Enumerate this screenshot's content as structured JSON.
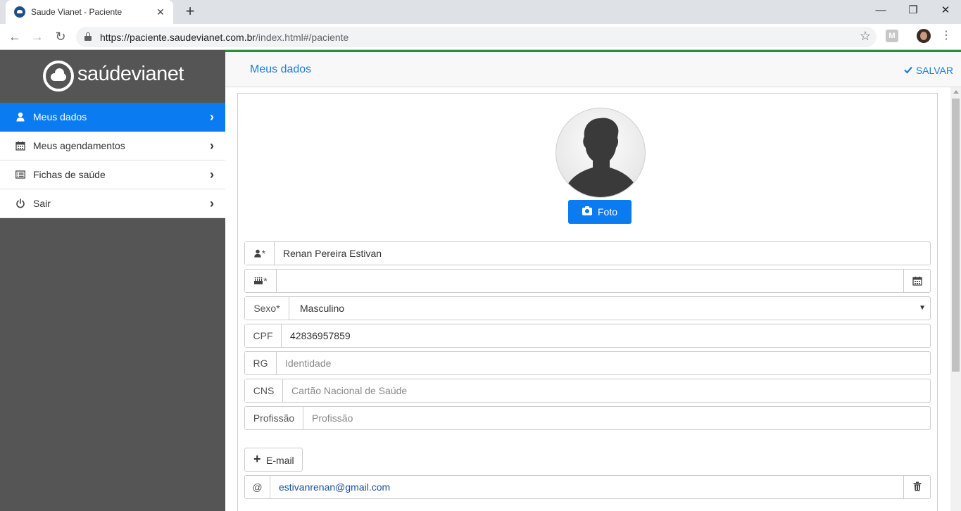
{
  "browser": {
    "tab_title": "Saude Vianet - Paciente",
    "url_scheme": "https://",
    "url_host": "paciente.saudevianet.com.br",
    "url_path": "/index.html#/paciente",
    "extension_label": "M"
  },
  "sidebar": {
    "brand": "saúdevianet",
    "items": [
      {
        "label": "Meus dados",
        "icon": "user-icon",
        "active": true
      },
      {
        "label": "Meus agendamentos",
        "icon": "calendar-icon",
        "active": false
      },
      {
        "label": "Fichas de saúde",
        "icon": "list-icon",
        "active": false
      },
      {
        "label": "Sair",
        "icon": "power-icon",
        "active": false
      }
    ]
  },
  "topbar": {
    "title": "Meus dados",
    "save_label": "SALVAR"
  },
  "profile": {
    "photo_button": "Foto",
    "fields": {
      "name": {
        "addon": "*",
        "icon": "user-icon",
        "value": "Renan Pereira Estivan"
      },
      "birthdate": {
        "addon": "*",
        "icon": "birthday-cake-icon",
        "value": ""
      },
      "sex": {
        "addon": "Sexo*",
        "value": "Masculino"
      },
      "cpf": {
        "addon": "CPF",
        "value": "42836957859"
      },
      "rg": {
        "addon": "RG",
        "placeholder": "Identidade"
      },
      "cns": {
        "addon": "CNS",
        "placeholder": "Cartão Nacional de Saúde"
      },
      "profession": {
        "addon": "Profissão",
        "placeholder": "Profissão"
      }
    },
    "add_email_label": "E-mail",
    "email": {
      "addon": "@",
      "value": "estivanrenan@gmail.com"
    }
  },
  "colors": {
    "primary": "#0a7bf0",
    "sidebar_bg": "#555555",
    "topbar_accent": "#2a8f3c",
    "link": "#1a7fe0"
  }
}
